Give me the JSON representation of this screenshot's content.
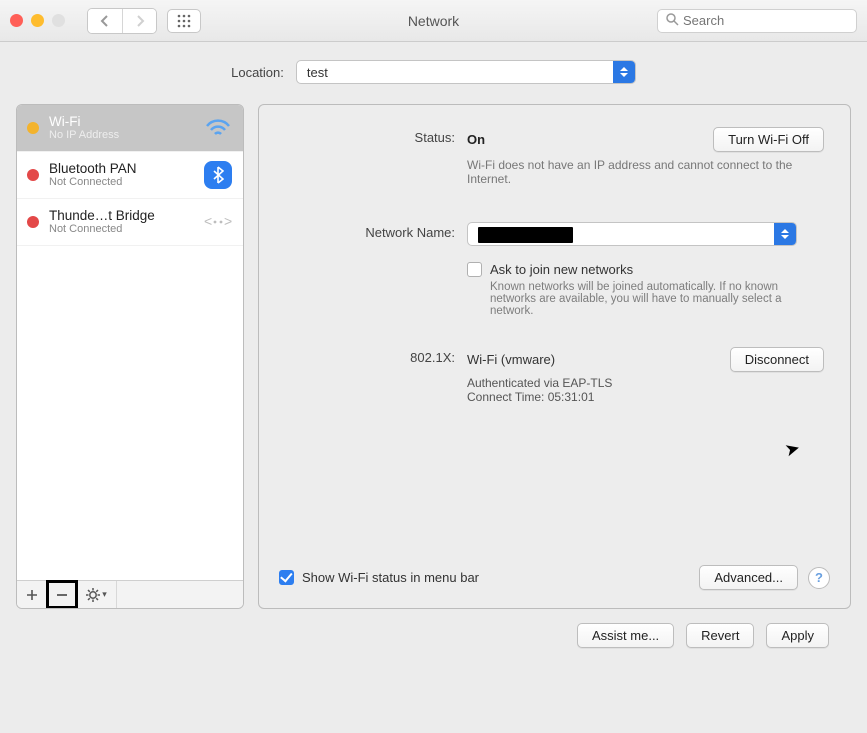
{
  "window": {
    "title": "Network",
    "search_placeholder": "Search"
  },
  "location": {
    "label": "Location:",
    "value": "test"
  },
  "sidebar": {
    "items": [
      {
        "name": "Wi-Fi",
        "sub": "No IP Address",
        "status": "yellow",
        "icon": "wifi",
        "selected": true
      },
      {
        "name": "Bluetooth PAN",
        "sub": "Not Connected",
        "status": "red",
        "icon": "bluetooth",
        "selected": false
      },
      {
        "name": "Thunde…t Bridge",
        "sub": "Not Connected",
        "status": "red",
        "icon": "thunderbolt",
        "selected": false
      }
    ]
  },
  "details": {
    "status_label": "Status:",
    "status_value": "On",
    "toggle_label": "Turn Wi-Fi Off",
    "status_sub": "Wi-Fi does not have an IP address and cannot connect to the Internet.",
    "network_name_label": "Network Name:",
    "network_name_value": "",
    "ask_join_label": "Ask to join new networks",
    "ask_join_checked": false,
    "ask_join_help": "Known networks will be joined automatically. If no known networks are available, you will have to manually select a network.",
    "x802_label": "802.1X:",
    "x802_name": "Wi-Fi (vmware)",
    "x802_disconnect": "Disconnect",
    "x802_sub1": "Authenticated via EAP-TLS",
    "x802_sub2": "Connect Time: 05:31:01",
    "show_status_label": "Show Wi-Fi status in menu bar",
    "show_status_checked": true,
    "advanced_label": "Advanced..."
  },
  "footer": {
    "assist": "Assist me...",
    "revert": "Revert",
    "apply": "Apply"
  }
}
